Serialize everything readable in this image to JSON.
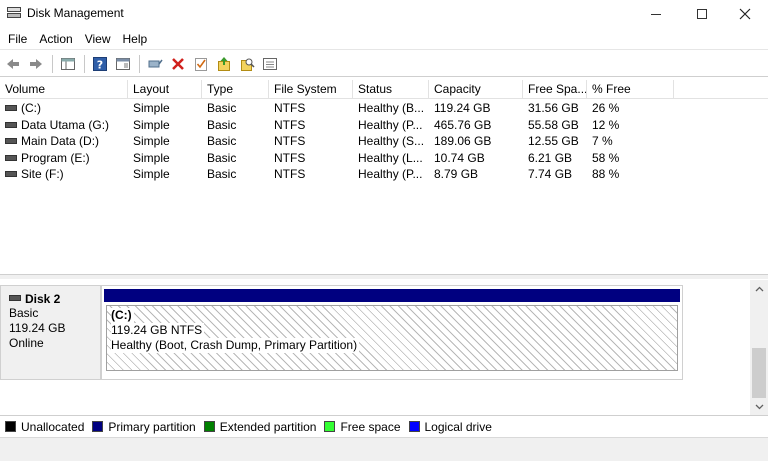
{
  "window": {
    "title": "Disk Management"
  },
  "menu": [
    "File",
    "Action",
    "View",
    "Help"
  ],
  "toolbar": {
    "icons": [
      "back-arrow-icon",
      "forward-arrow-icon",
      "console-tree-icon",
      "help-icon",
      "properties-icon",
      "connect-icon",
      "delete-icon",
      "checklist-icon",
      "import-icon",
      "search-icon",
      "list-view-icon"
    ]
  },
  "volumes": {
    "headers": [
      "Volume",
      "Layout",
      "Type",
      "File System",
      "Status",
      "Capacity",
      "Free Spa...",
      "% Free"
    ],
    "rows": [
      {
        "name": "(C:)",
        "layout": "Simple",
        "type": "Basic",
        "fs": "NTFS",
        "status": "Healthy (B...",
        "capacity": "119.24 GB",
        "free": "31.56 GB",
        "pct": "26 %"
      },
      {
        "name": "Data Utama (G:)",
        "layout": "Simple",
        "type": "Basic",
        "fs": "NTFS",
        "status": "Healthy (P...",
        "capacity": "465.76 GB",
        "free": "55.58 GB",
        "pct": "12 %"
      },
      {
        "name": "Main Data (D:)",
        "layout": "Simple",
        "type": "Basic",
        "fs": "NTFS",
        "status": "Healthy (S...",
        "capacity": "189.06 GB",
        "free": "12.55 GB",
        "pct": "7 %"
      },
      {
        "name": "Program (E:)",
        "layout": "Simple",
        "type": "Basic",
        "fs": "NTFS",
        "status": "Healthy (L...",
        "capacity": "10.74 GB",
        "free": "6.21 GB",
        "pct": "58 %"
      },
      {
        "name": "Site (F:)",
        "layout": "Simple",
        "type": "Basic",
        "fs": "NTFS",
        "status": "Healthy (P...",
        "capacity": "8.79 GB",
        "free": "7.74 GB",
        "pct": "88 %"
      }
    ]
  },
  "disk": {
    "name": "Disk 2",
    "type": "Basic",
    "size": "119.24 GB",
    "state": "Online",
    "partition": {
      "label": "(C:)",
      "size_fs": "119.24 GB NTFS",
      "status": "Healthy (Boot, Crash Dump, Primary Partition)"
    }
  },
  "legend": [
    {
      "label": "Unallocated",
      "color": "#000000"
    },
    {
      "label": "Primary partition",
      "color": "#000080"
    },
    {
      "label": "Extended partition",
      "color": "#008000"
    },
    {
      "label": "Free space",
      "color": "#33ff33"
    },
    {
      "label": "Logical drive",
      "color": "#0000ff"
    }
  ]
}
